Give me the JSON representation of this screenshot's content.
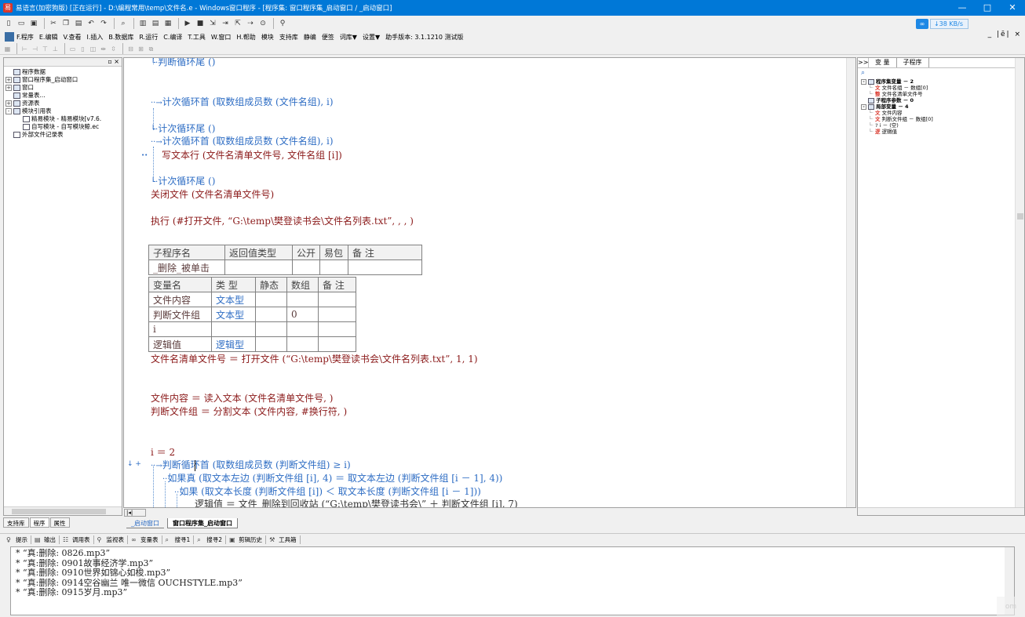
{
  "window": {
    "title": "易语言(加密狗版) [正在运行] - D:\\编程常用\\temp\\文件名.e - Windows窗口程序 - [程序集: 窗口程序集_启动窗口 / _启动窗口]",
    "app_icon": "易",
    "controls": {
      "minimize": "—",
      "maximize": "□",
      "close": "✕"
    }
  },
  "network": {
    "speed": "↓38 KB/s"
  },
  "menu": {
    "items": [
      "F.程序",
      "E.编辑",
      "V.查看",
      "I.插入",
      "B.数据库",
      "R.运行",
      "C.编译",
      "T.工具",
      "W.窗口",
      "H.帮助",
      "模块",
      "支持库",
      "静编",
      "便签",
      "词库▼",
      "设置▼",
      "助手版本: 3.1.1210 测试版"
    ],
    "mdi": "_ |ē| ×"
  },
  "left_panel": {
    "close": "▫ ×",
    "tree": [
      {
        "label": "程序数据",
        "level": 0,
        "expander": "",
        "icon": "folder"
      },
      {
        "label": "窗口程序集_启动窗口",
        "level": 0,
        "expander": "+",
        "icon": "module"
      },
      {
        "label": "窗口",
        "level": 0,
        "expander": "+",
        "icon": "window"
      },
      {
        "label": "常量表...",
        "level": 0,
        "expander": "",
        "icon": "const"
      },
      {
        "label": "资源表",
        "level": 0,
        "expander": "+",
        "icon": "res"
      },
      {
        "label": "模块引用表",
        "level": 0,
        "expander": "-",
        "icon": "module"
      },
      {
        "label": "精易模块 - 精易模块[v7.6.",
        "level": 1,
        "expander": "",
        "icon": "doc"
      },
      {
        "label": "自写模块 - 自写模块鲸.ec",
        "level": 1,
        "expander": "",
        "icon": "doc"
      },
      {
        "label": "外部文件记录表",
        "level": 0,
        "expander": "",
        "icon": "doc"
      }
    ],
    "tabs": [
      "支持库",
      "程序",
      "属性"
    ]
  },
  "editor": {
    "lines": [
      {
        "kind": "loop-end",
        "text": "判断循环尾 ()"
      },
      {
        "kind": "loop-start",
        "text": "计次循环首 (取数组成员数 (文件名组), i)"
      },
      {
        "kind": "loop-end",
        "text": "计次循环尾 ()"
      },
      {
        "kind": "loop-start",
        "text": "计次循环首 (取数组成员数 (文件名组), i)"
      },
      {
        "kind": "stmt",
        "text": "写文本行 (文件名清单文件号, 文件名组 [i])"
      },
      {
        "kind": "loop-end",
        "text": "计次循环尾 ()"
      },
      {
        "kind": "stmt",
        "text": "关闭文件 (文件名清单文件号)"
      },
      {
        "kind": "stmt",
        "text": "执行 (#打开文件, “G:\\temp\\樊登读书会\\文件名列表.txt”, , , )"
      },
      {
        "kind": "stmt",
        "text": "文件名清单文件号 ＝ 打开文件 (“G:\\temp\\樊登读书会\\文件名列表.txt”, 1, 1)"
      },
      {
        "kind": "stmt",
        "text": "文件内容 ＝ 读入文本 (文件名清单文件号, )"
      },
      {
        "kind": "stmt",
        "text": "判断文件组 ＝ 分割文本 (文件内容, #换行符, )"
      },
      {
        "kind": "stmt",
        "text": "i ＝ 2"
      },
      {
        "kind": "loop-start",
        "text": "判断循环首 (取数组成员数 (判断文件组) ≥ i)"
      },
      {
        "kind": "branch",
        "text": "如果真 (取文本左边 (判断文件组 [i], 4) ＝ 取文本左边 (判断文件组 [i － 1], 4))"
      },
      {
        "kind": "branch",
        "text": "如果 (取文本长度 (判断文件组 [i]) ＜ 取文本长度 (判断文件组 [i － 1]))"
      },
      {
        "kind": "stmt",
        "text": "逻辑值 ＝ 文件_删除到回收站 (“G:\\temp\\樊登读书会\\” ＋ 判断文件组 [i], 7)"
      }
    ],
    "gutter_marks": {
      "write_line": "••",
      "loop_line": "↓ +"
    },
    "sub_table": {
      "headers": [
        "子程序名",
        "返回值类型",
        "公开",
        "易包",
        "备 注"
      ],
      "row": [
        "_删除_被单击",
        "",
        "",
        "",
        ""
      ]
    },
    "var_table": {
      "headers": [
        "变量名",
        "类 型",
        "静态",
        "数组",
        "备 注"
      ],
      "rows": [
        [
          "文件内容",
          "文本型",
          "",
          "",
          ""
        ],
        [
          "判断文件组",
          "文本型",
          "",
          "0",
          ""
        ],
        [
          "i",
          "",
          "",
          "",
          ""
        ],
        [
          "逻辑值",
          "逻辑型",
          "",
          "",
          ""
        ]
      ]
    },
    "tabs": [
      "_启动窗口",
      "窗口程序集_启动窗口"
    ],
    "hscroll_btn": "|◂|"
  },
  "right_panel": {
    "collapse": ">>",
    "tabs": [
      "变 量",
      "子程序"
    ],
    "search_icon": "⌕",
    "tree": [
      {
        "label": "程序集变量 － 2",
        "level": 0,
        "expander": "-",
        "badge": "",
        "bold": true
      },
      {
        "label": "文件名组 － 数组[0]",
        "level": 1,
        "expander": "",
        "badge": "文",
        "bold": false
      },
      {
        "label": "文件名清单文件号",
        "level": 1,
        "expander": "",
        "badge": "整",
        "bold": false
      },
      {
        "label": "子程序参数 － 0",
        "level": 0,
        "expander": "",
        "badge": "",
        "bold": true
      },
      {
        "label": "局部变量 － 4",
        "level": 0,
        "expander": "-",
        "badge": "",
        "bold": true
      },
      {
        "label": "文件内容",
        "level": 1,
        "expander": "",
        "badge": "文",
        "bold": false
      },
      {
        "label": "判断文件组 － 数组[0]",
        "level": 1,
        "expander": "",
        "badge": "文",
        "bold": false
      },
      {
        "label": "i － (空)",
        "level": 1,
        "expander": "",
        "badge": "?",
        "bold": false
      },
      {
        "label": "逻辑值",
        "level": 1,
        "expander": "",
        "badge": "逻",
        "bold": false
      }
    ]
  },
  "output": {
    "tabs": [
      "提示",
      "输出",
      "调用表",
      "监视表",
      "变量表",
      "搜寻1",
      "搜寻2",
      "剪辑历史",
      "工具箱"
    ],
    "lines": [
      "*  “真:删除: 0826.mp3”",
      "*  “真:删除: 0901故事经济学.mp3”",
      "*  “真:删除: 0910世界如锦心如梭.mp3”",
      "*  “真:删除: 0914空谷幽兰 唯一微信 OUCHSTYLE.mp3”",
      "*  “真:删除: 0915岁月.mp3”"
    ]
  }
}
